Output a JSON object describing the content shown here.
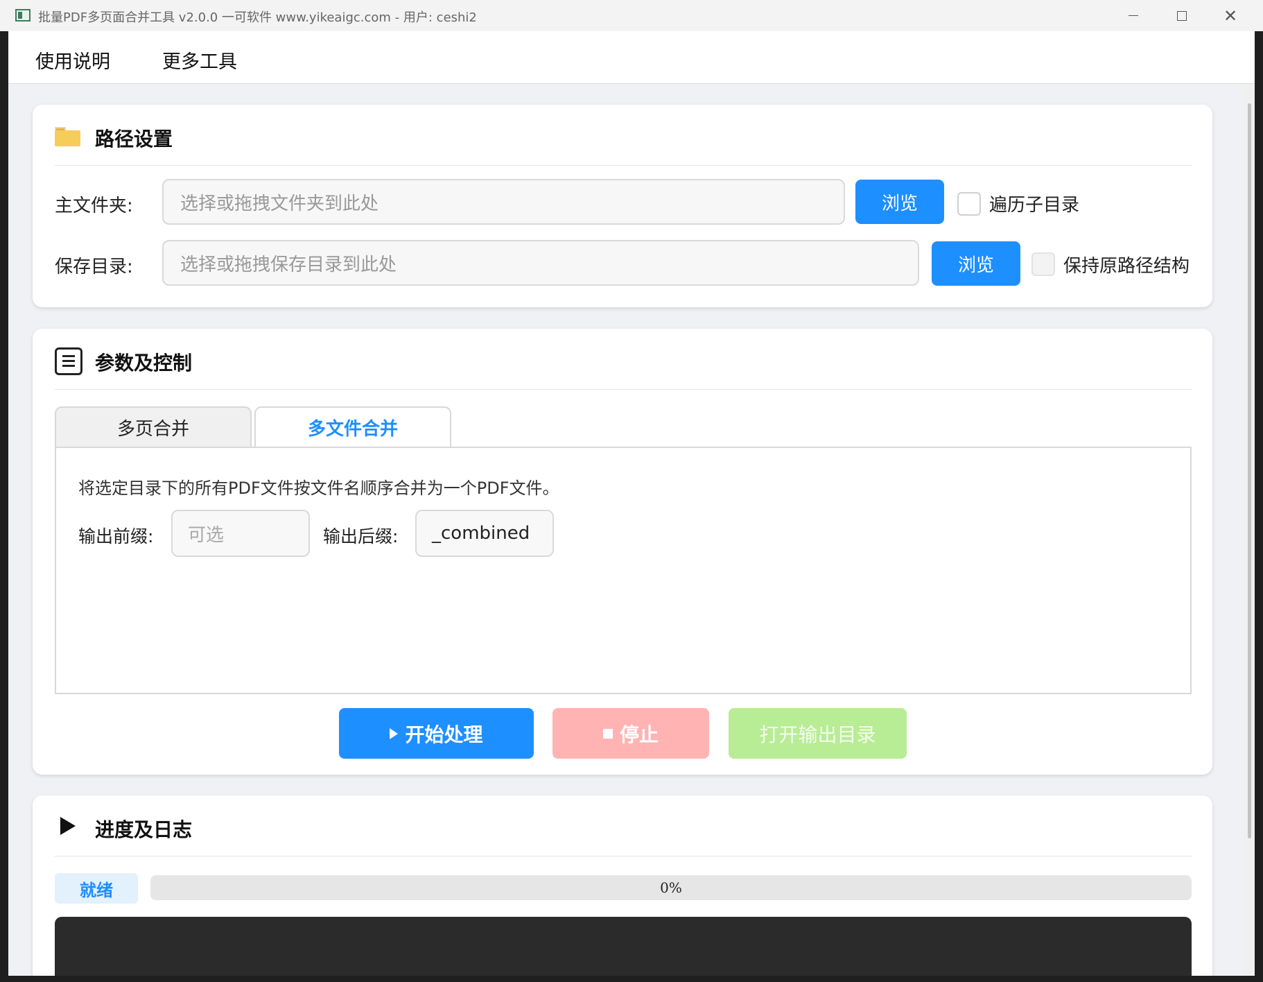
{
  "window": {
    "title": "批量PDF多页面合并工具 v2.0.0 一可软件 www.yikeaigc.com - 用户: ceshi2"
  },
  "menu": {
    "items": [
      "使用说明",
      "更多工具"
    ]
  },
  "path_settings": {
    "title": "路径设置",
    "main_folder_label": "主文件夹:",
    "main_folder_placeholder": "选择或拖拽文件夹到此处",
    "browse_label": "浏览",
    "traverse_label": "遍历子目录",
    "save_dir_label": "保存目录:",
    "save_dir_placeholder": "选择或拖拽保存目录到此处",
    "keep_structure_label": "保持原路径结构"
  },
  "params": {
    "title": "参数及控制",
    "tabs": [
      {
        "label": "多页合并",
        "active": false
      },
      {
        "label": "多文件合并",
        "active": true
      }
    ],
    "description": "将选定目录下的所有PDF文件按文件名顺序合并为一个PDF文件。",
    "prefix_label": "输出前缀:",
    "prefix_placeholder": "可选",
    "suffix_label": "输出后缀:",
    "suffix_value": "_combined",
    "start_label": "开始处理",
    "stop_label": "停止",
    "open_output_label": "打开输出目录"
  },
  "progress_log": {
    "title": "进度及日志",
    "status": "就绪",
    "progress_percent": 0,
    "progress_text": "0%"
  },
  "colors": {
    "accent": "#1e8fff",
    "stop": "#ffb3b3",
    "open": "#b8ec95",
    "log_bg": "#2b2b2b"
  }
}
